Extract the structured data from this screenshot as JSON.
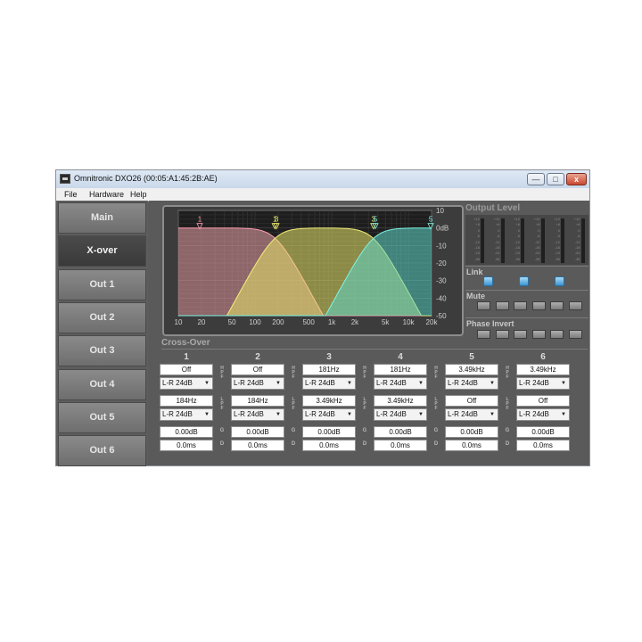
{
  "window": {
    "title": "Omnitronic DXO26 (00:05:A1:45:2B:AE)",
    "min_label": "—",
    "max_label": "□",
    "close_label": "x"
  },
  "menu": [
    "File",
    "Hardware",
    "Help"
  ],
  "sidebar": [
    "Main",
    "X-over",
    "Out 1",
    "Out 2",
    "Out 3",
    "Out 4",
    "Out 5",
    "Out 6"
  ],
  "active_tab": "X-over",
  "graph": {
    "x_ticks": [
      "10",
      "20",
      "50",
      "100",
      "200",
      "500",
      "1k",
      "2k",
      "5k",
      "10k",
      "20k"
    ],
    "y_ticks": [
      "10",
      "0dB",
      "-10",
      "-20",
      "-30",
      "-40",
      "-50"
    ],
    "x_range_hz": [
      10,
      20000
    ],
    "y_range_db": [
      -50,
      10
    ],
    "markers": [
      {
        "label": "1",
        "freq_hz": 19,
        "color": "#ff9db2"
      },
      {
        "label": "1",
        "freq_hz": 181,
        "color": "#f0f070"
      },
      {
        "label": "3",
        "freq_hz": 190,
        "color": "#f0f070"
      },
      {
        "label": "3",
        "freq_hz": 3490,
        "color": "#f0f070"
      },
      {
        "label": "5",
        "freq_hz": 3700,
        "color": "#7ff5e6"
      },
      {
        "label": "5",
        "freq_hz": 19500,
        "color": "#7ff5e6"
      }
    ],
    "curves": [
      {
        "name": "",
        "hpf_hz": null,
        "lpf_hz": 184,
        "fill": "#e9a2a8",
        "stroke": "#ff9db2"
      },
      {
        "name": "",
        "hpf_hz": 181,
        "lpf_hz": 3490,
        "fill": "#e8e46a",
        "stroke": "#f3ef7a"
      },
      {
        "name": "",
        "hpf_hz": 3490,
        "lpf_hz": null,
        "fill": "#5fd7c8",
        "stroke": "#7ff5e6"
      }
    ]
  },
  "output_level": {
    "title": "Output Level",
    "scale": [
      "+12",
      "+6",
      "0",
      "-6",
      "-12",
      "-18",
      "-24",
      "-36"
    ]
  },
  "link": {
    "label": "Link"
  },
  "mute": {
    "label": "Mute"
  },
  "phase_invert": {
    "label": "Phase Invert"
  },
  "crossover": {
    "label": "Cross-Over",
    "hpf_letters": [
      "H",
      "P",
      "F"
    ],
    "lpf_letters": [
      "L",
      "P",
      "F"
    ],
    "gain_letter": "G",
    "delay_letter": "D",
    "columns": [
      {
        "num": "1",
        "hpf_freq": "Off",
        "hpf_type": "L-R 24dB",
        "lpf_freq": "184Hz",
        "lpf_type": "L-R 24dB",
        "gain": "0.00dB",
        "delay": "0.0ms"
      },
      {
        "num": "2",
        "hpf_freq": "Off",
        "hpf_type": "L-R 24dB",
        "lpf_freq": "184Hz",
        "lpf_type": "L-R 24dB",
        "gain": "0.00dB",
        "delay": "0.0ms"
      },
      {
        "num": "3",
        "hpf_freq": "181Hz",
        "hpf_type": "L-R 24dB",
        "lpf_freq": "3.49kHz",
        "lpf_type": "L-R 24dB",
        "gain": "0.00dB",
        "delay": "0.0ms"
      },
      {
        "num": "4",
        "hpf_freq": "181Hz",
        "hpf_type": "L-R 24dB",
        "lpf_freq": "3.49kHz",
        "lpf_type": "L-R 24dB",
        "gain": "0.00dB",
        "delay": "0.0ms"
      },
      {
        "num": "5",
        "hpf_freq": "3.49kHz",
        "hpf_type": "L-R 24dB",
        "lpf_freq": "Off",
        "lpf_type": "L-R 24dB",
        "gain": "0.00dB",
        "delay": "0.0ms"
      },
      {
        "num": "6",
        "hpf_freq": "3.49kHz",
        "hpf_type": "L-R 24dB",
        "lpf_freq": "Off",
        "lpf_type": "L-R 24dB",
        "gain": "0.00dB",
        "delay": "0.0ms"
      }
    ]
  }
}
